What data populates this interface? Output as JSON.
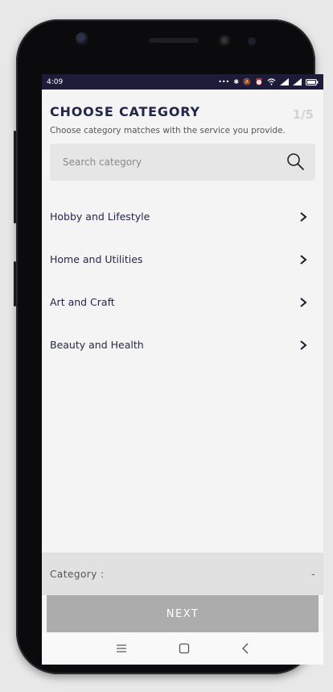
{
  "status_bar": {
    "time": "4:09",
    "icons": [
      "more-icon",
      "bluetooth-icon",
      "mute-icon",
      "alarm-icon",
      "wifi-icon",
      "signal-icon",
      "signal-icon",
      "battery-icon"
    ]
  },
  "header": {
    "title": "CHOOSE CATEGORY",
    "step": "1/5",
    "subtitle": "Choose category matches with the service you provide."
  },
  "search": {
    "placeholder": "Search category"
  },
  "categories": [
    {
      "label": "Hobby and Lifestyle"
    },
    {
      "label": "Home and Utilities"
    },
    {
      "label": "Art and Craft"
    },
    {
      "label": "Beauty and Health"
    }
  ],
  "footer": {
    "category_label": "Category :",
    "category_value": "-",
    "next_label": "NEXT"
  },
  "colors": {
    "primary": "#232549",
    "status_bar": "#1c1c38",
    "next_button": "#acacac"
  }
}
